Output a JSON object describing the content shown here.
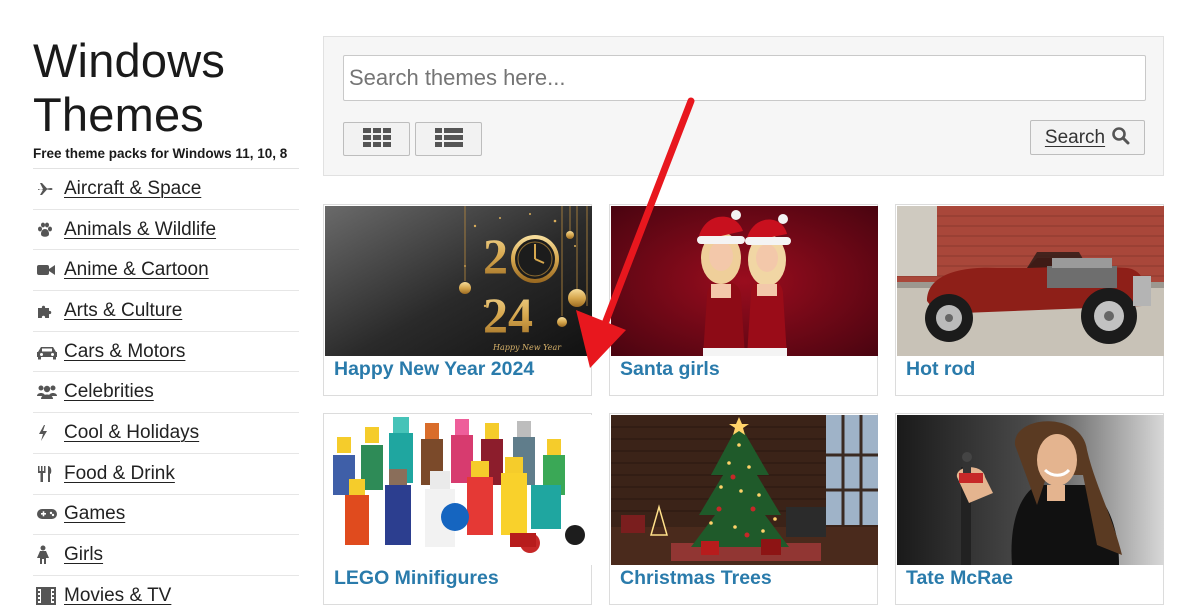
{
  "site": {
    "title_line1": "Windows",
    "title_line2": "Themes",
    "tagline": "Free theme packs for Windows 11, 10, 8"
  },
  "sidebar": {
    "categories": [
      {
        "label": "Aircraft & Space",
        "icon": "plane-icon"
      },
      {
        "label": "Animals & Wildlife",
        "icon": "paw-icon"
      },
      {
        "label": "Anime & Cartoon",
        "icon": "video-camera-icon"
      },
      {
        "label": "Arts & Culture",
        "icon": "puzzle-icon"
      },
      {
        "label": "Cars & Motors",
        "icon": "car-icon"
      },
      {
        "label": "Celebrities",
        "icon": "users-icon"
      },
      {
        "label": "Cool & Holidays",
        "icon": "lightning-icon"
      },
      {
        "label": "Food & Drink",
        "icon": "cutlery-icon"
      },
      {
        "label": "Games",
        "icon": "gamepad-icon"
      },
      {
        "label": "Girls",
        "icon": "female-icon"
      },
      {
        "label": "Movies & TV",
        "icon": "film-icon"
      }
    ]
  },
  "search": {
    "placeholder": "Search themes here...",
    "value": "",
    "button_label": "Search",
    "button_icon": "search-icon",
    "view_grid_icon": "grid-view-icon",
    "view_list_icon": "list-view-icon"
  },
  "themes": [
    {
      "title": "Happy New Year 2024",
      "thumb_text_year": "2024",
      "thumb_text_caption": "Happy New Year"
    },
    {
      "title": "Santa girls"
    },
    {
      "title": "Hot rod"
    },
    {
      "title": "LEGO Minifigures"
    },
    {
      "title": "Christmas Trees"
    },
    {
      "title": "Tate McRae"
    }
  ],
  "colors": {
    "link_blue": "#2a7bab",
    "arrow_red": "#e8171e",
    "panel_bg": "#f6f6f6"
  }
}
